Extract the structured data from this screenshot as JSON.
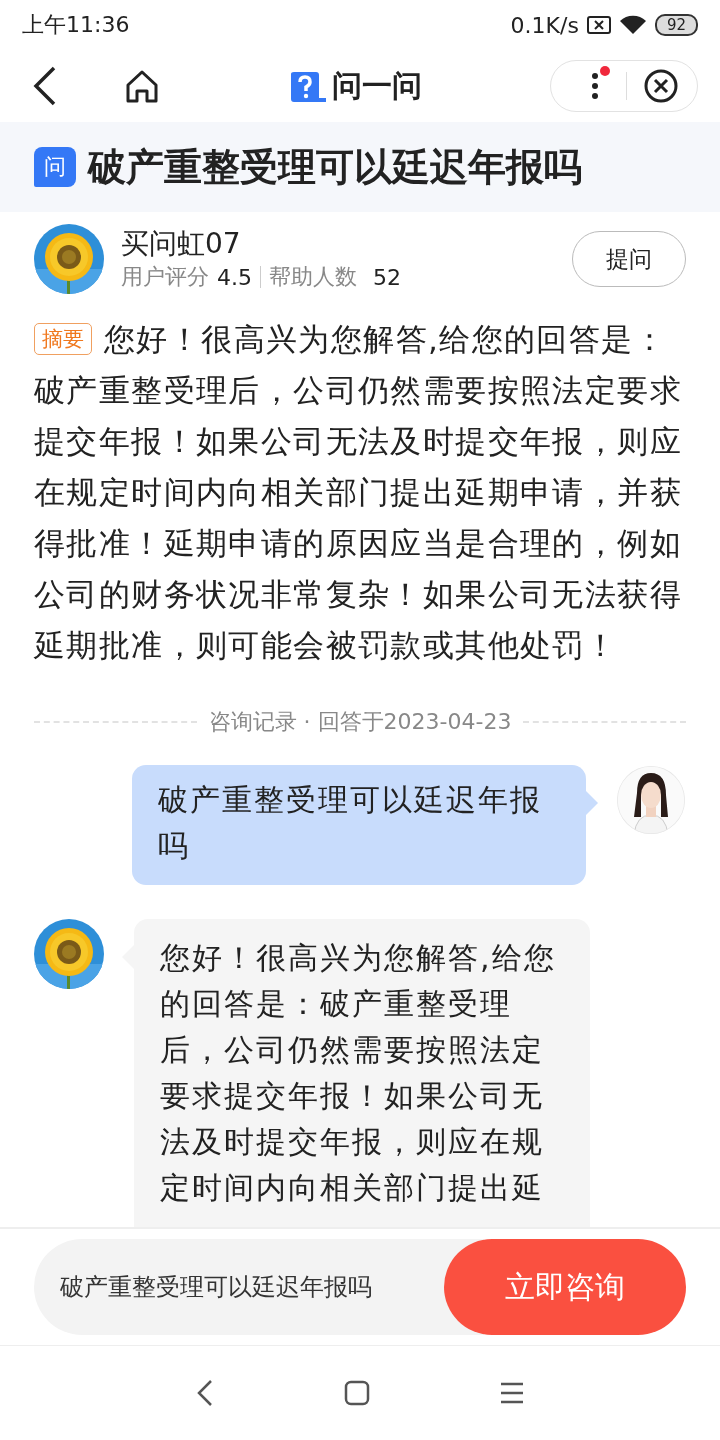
{
  "status_bar": {
    "time": "上午11:36",
    "speed": "0.1K/s",
    "battery": "92"
  },
  "header": {
    "title": "问一问",
    "menu_badge": true
  },
  "question": {
    "tag": "问",
    "title": "破产重整受理可以廷迟年报吗"
  },
  "answerer": {
    "name": "买问虹07",
    "rating_label": "用户评分",
    "rating": "4.5",
    "helped_label": "帮助人数",
    "helped": "52",
    "ask_button": "提问"
  },
  "summary": {
    "tag": "摘要",
    "text": "您好！很高兴为您解答,给您的回答是：破产重整受理后，公司仍然需要按照法定要求提交年报！如果公司无法及时提交年报，则应在规定时间内向相关部门提出延期申请，并获得批准！延期申请的原因应当是合理的，例如公司的财务状况非常复杂！如果公司无法获得延期批准，则可能会被罚款或其他处罚！"
  },
  "record_label": "咨询记录 · 回答于2023-04-23",
  "messages": [
    {
      "kind": "user",
      "text": "破产重整受理可以廷迟年报吗"
    },
    {
      "kind": "expert",
      "text": "您好！很高兴为您解答,给您的回答是：破产重整受理后，公司仍然需要按照法定要求提交年报！如果公司无法及时提交年报，则应在规定时间内向相关部门提出延"
    }
  ],
  "consult_bar": {
    "field_value": "破产重整受理可以廷迟年报吗",
    "button": "立即咨询"
  }
}
